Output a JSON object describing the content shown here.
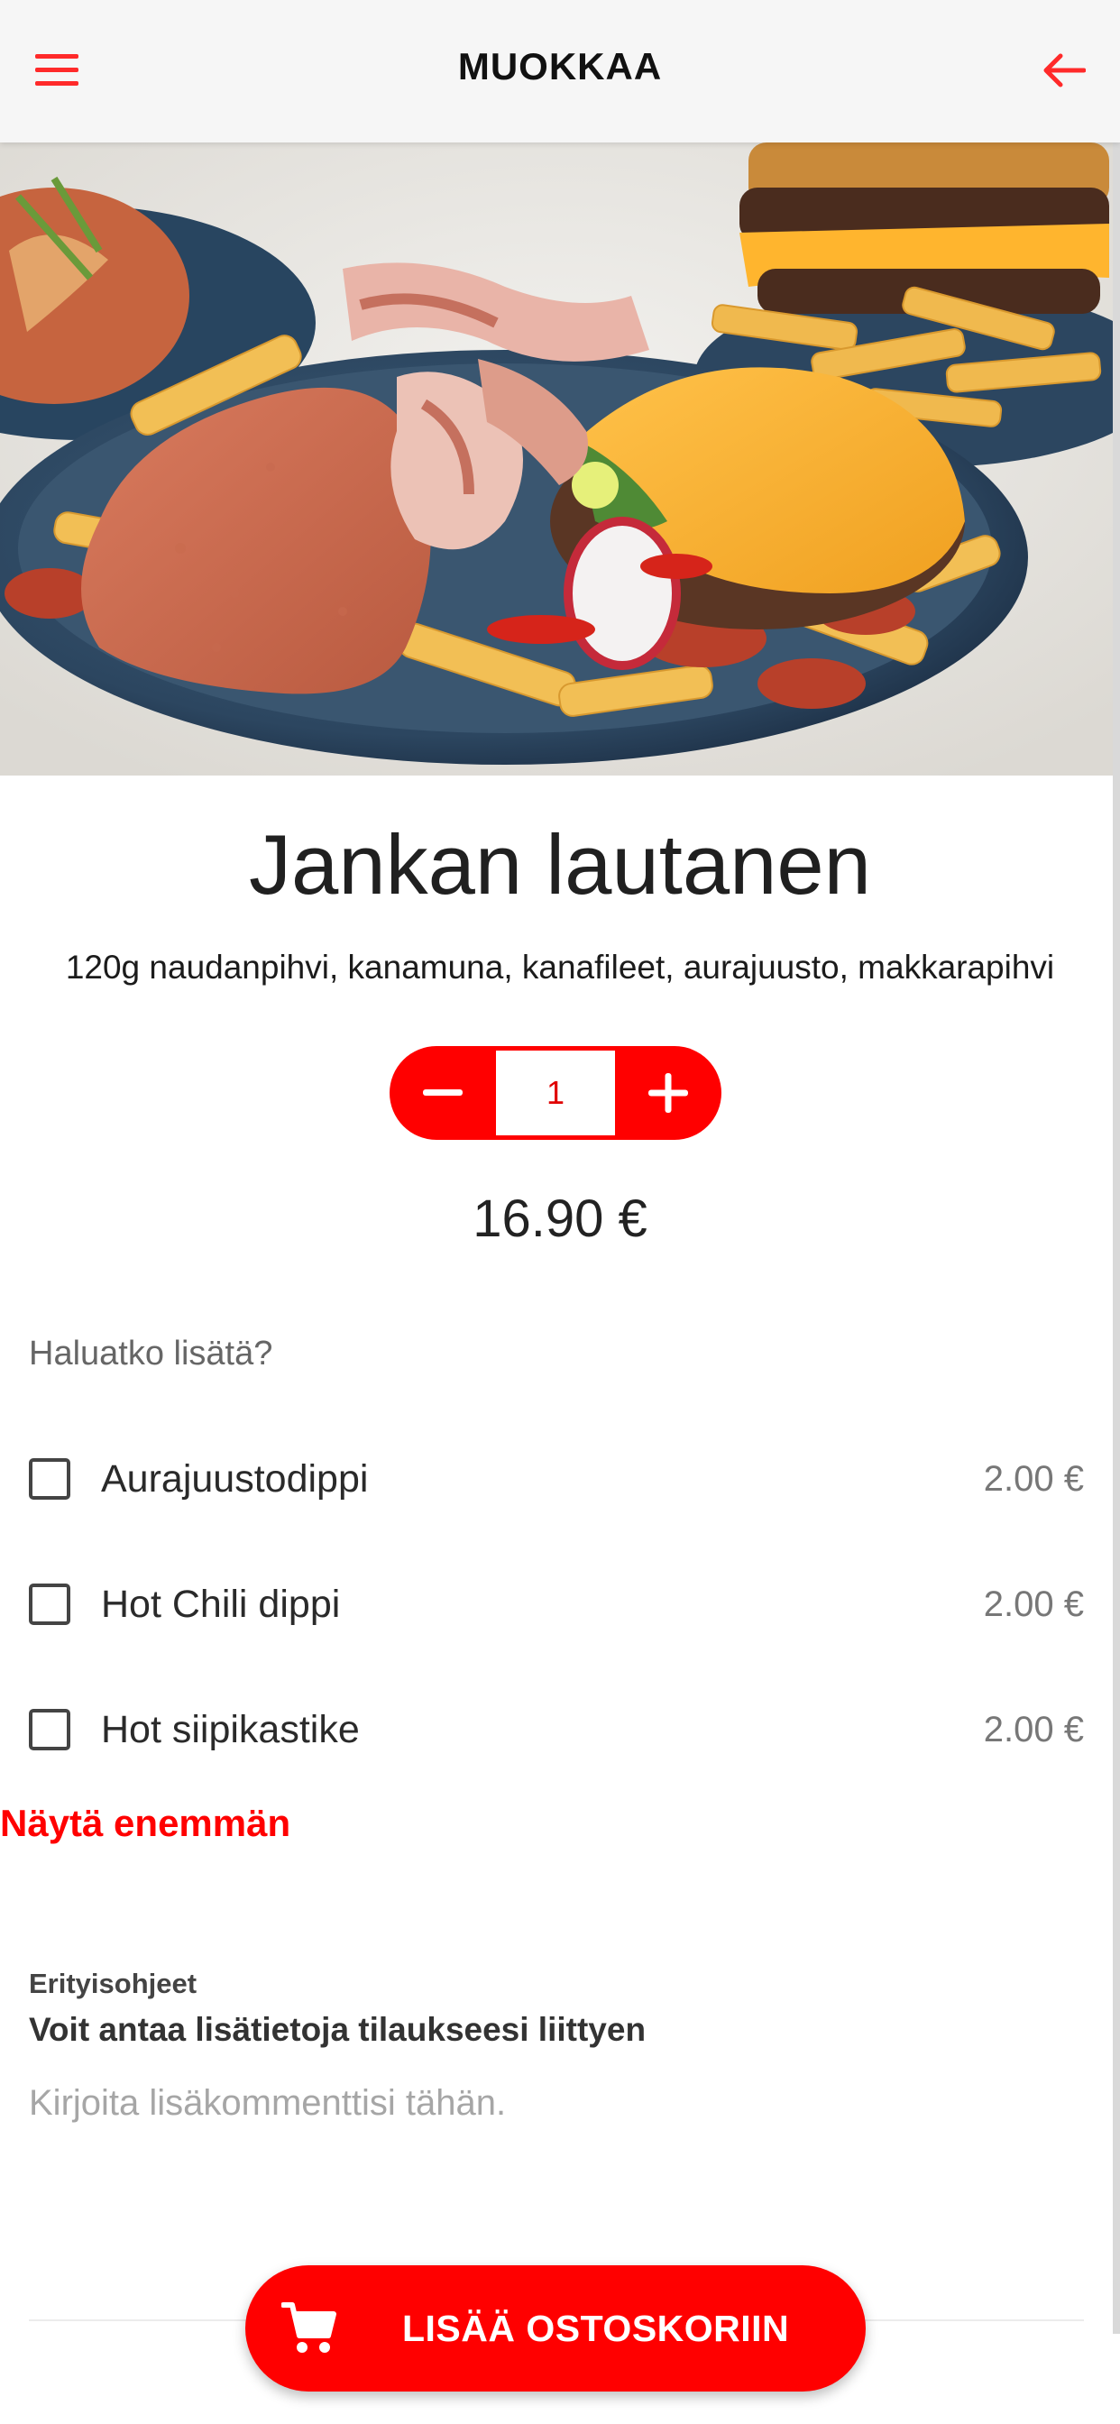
{
  "header": {
    "title": "MUOKKAA",
    "menu_icon": "hamburger-menu-icon",
    "back_icon": "arrow-left-icon"
  },
  "product": {
    "image_icon": "food-plate-photo",
    "name": "Jankan lautanen",
    "description": "120g naudanpihvi, kanamuna, kanafileet, aurajuusto, makkarapihvi",
    "quantity": "1",
    "price": "16.90 €"
  },
  "extras": {
    "heading": "Haluatko lisätä?",
    "items": [
      {
        "label": "Aurajuustodippi",
        "price": "2.00 €",
        "checked": false
      },
      {
        "label": "Hot Chili dippi",
        "price": "2.00 €",
        "checked": false
      },
      {
        "label": "Hot siipikastike",
        "price": "2.00 €",
        "checked": false
      }
    ],
    "show_more": "Näytä enemmän"
  },
  "instructions": {
    "label": "Erityisohjeet",
    "subtitle": "Voit antaa lisätietoja tilaukseesi liittyen",
    "placeholder": "Kirjoita lisäkommenttisi tähän.",
    "value": ""
  },
  "cart_button": {
    "label": "LISÄÄ OSTOSKORIIN",
    "icon": "shopping-cart-icon"
  },
  "colors": {
    "accent": "#ff0000",
    "topbar_bg": "#f6f6f6",
    "text": "#222222",
    "muted": "#777777"
  }
}
